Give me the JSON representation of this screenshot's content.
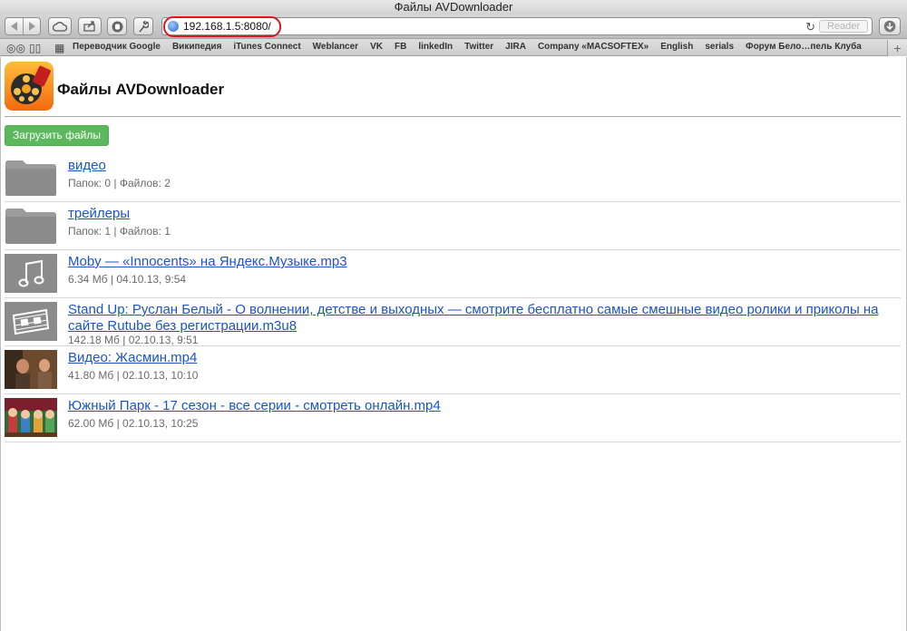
{
  "window": {
    "title": "Файлы AVDownloader"
  },
  "toolbar": {
    "url": "192.168.1.5:8080/",
    "reader_label": "Reader"
  },
  "bookmarks": [
    "Переводчик Google",
    "Википедия",
    "iTunes Connect",
    "Weblancer",
    "VK",
    "FB",
    "linkedIn",
    "Twitter",
    "JIRA",
    "Company «MACSOFTEX»",
    "English",
    "serials",
    "Форум Бело…пель Клуба"
  ],
  "page": {
    "title": "Файлы AVDownloader",
    "upload_button": "Загрузить файлы",
    "files": [
      {
        "name": "видео",
        "meta": "Папок: 0 | Файлов: 2",
        "kind": "folder-icon"
      },
      {
        "name": "трейлеры",
        "meta": "Папок: 1 | Файлов: 1",
        "kind": "folder-icon"
      },
      {
        "name": "Moby — «Innocents» на Яндекс.Музыке.mp3",
        "meta": "6.34 Мб | 04.10.13, 9:54",
        "kind": "music-note-icon"
      },
      {
        "name": "Stand Up: Руслан Белый - О волнении, детстве и выходных — смотрите бесплатно самые смешные видео ролики и приколы на сайте Rutube без регистрации.m3u8",
        "meta": "142.18 Мб | 02.10.13, 9:51",
        "kind": "film-strip-icon"
      },
      {
        "name": "Видео: Жасмин.mp4",
        "meta": "41.80 Мб | 02.10.13, 10:10",
        "kind": "video-thumbnail"
      },
      {
        "name": "Южный Парк - 17 сезон - все серии - смотреть онлайн.mp4",
        "meta": "62.00 Мб | 02.10.13, 10:25",
        "kind": "video-thumbnail"
      }
    ]
  }
}
